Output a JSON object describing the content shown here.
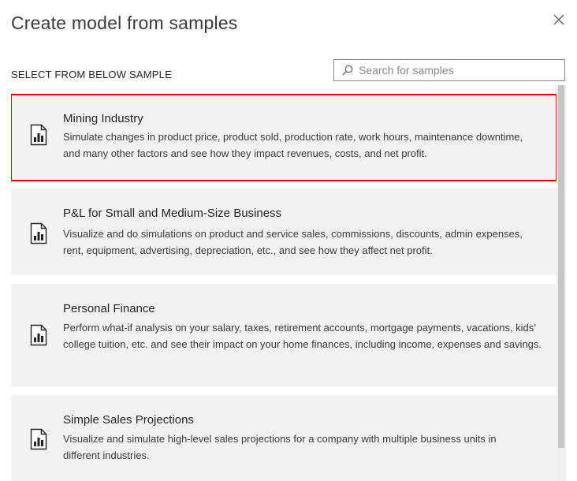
{
  "dialog": {
    "title": "Create model from samples",
    "section_label": "SELECT FROM BELOW SAMPLE"
  },
  "search": {
    "placeholder": "Search for samples",
    "value": ""
  },
  "icons": {
    "close": "close-icon",
    "search": "search-icon",
    "sample": "report-chart-icon"
  },
  "colors": {
    "card_background": "#f3f2f1",
    "selection_outline": "#e00000",
    "scrollbar_thumb": "#c8c6c4"
  },
  "samples": [
    {
      "title": "Mining Industry",
      "description": "Simulate changes in product price, product sold, production rate, work hours, maintenance downtime, and many other factors and see how they impact revenues, costs, and net profit.",
      "selected": true
    },
    {
      "title": "P&L for Small and Medium-Size Business",
      "description": "Visualize and do simulations on product and service sales, commissions, discounts, admin expenses, rent, equipment, advertising, depreciation, etc., and see how they affect net profit.",
      "selected": false
    },
    {
      "title": "Personal Finance",
      "description": "Perform what-if analysis on your salary, taxes, retirement accounts, mortgage payments, vacations, kids’ college tuition, etc. and see their impact on your home finances, including income, expenses and savings.",
      "selected": false
    },
    {
      "title": "Simple Sales Projections",
      "description": "Visualize and simulate high-level sales projections for a company with multiple business units in different industries.",
      "selected": false
    }
  ]
}
